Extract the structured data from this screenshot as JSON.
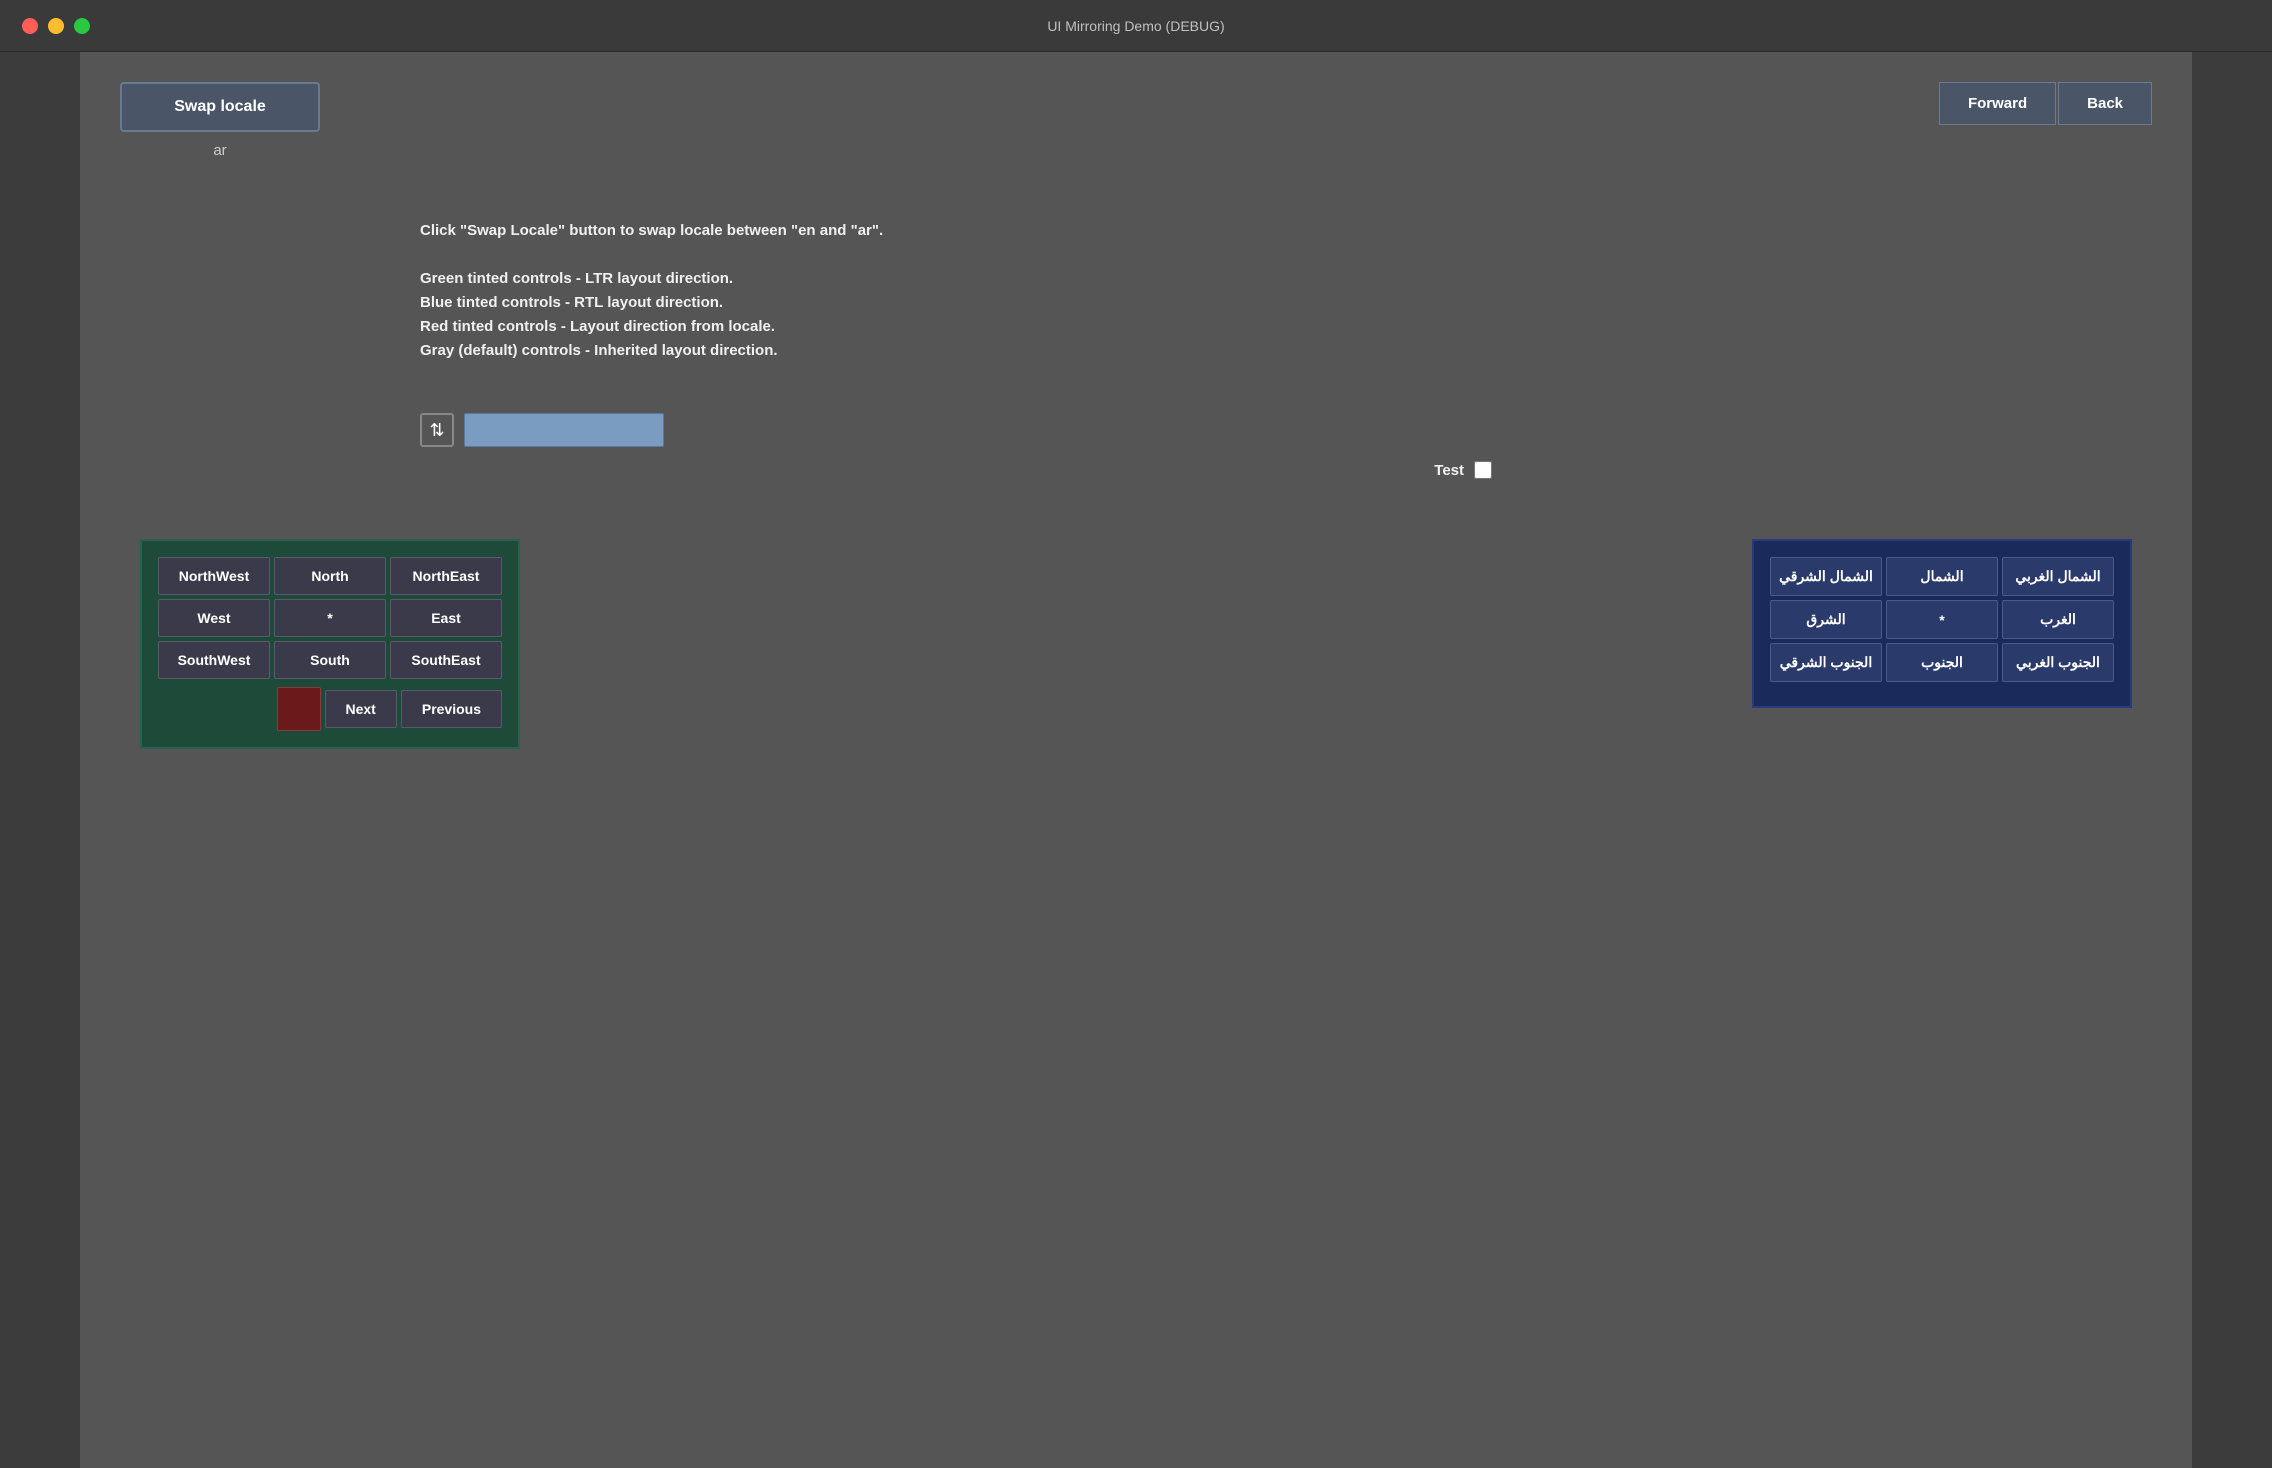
{
  "titlebar": {
    "title": "UI Mirroring Demo (DEBUG)"
  },
  "toolbar": {
    "swap_locale_label": "Swap locale",
    "locale_value": "ar",
    "forward_label": "Forward",
    "back_label": "Back"
  },
  "instructions": {
    "line1": "Click \"Swap Locale\" button to swap locale between \"en  and \"ar\".",
    "line2": "Green tinted controls - LTR layout direction.",
    "line3": "Blue tinted controls - RTL layout direction.",
    "line4": "Red tinted controls - Layout direction from locale.",
    "line5": "Gray (default) controls - Inherited layout direction."
  },
  "test_row": {
    "label": "Test"
  },
  "ltr_panel": {
    "northwest": "NorthWest",
    "north": "North",
    "northeast": "NorthEast",
    "west": "West",
    "center": "*",
    "east": "East",
    "southwest": "SouthWest",
    "south": "South",
    "southeast": "SouthEast",
    "next": "Next",
    "previous": "Previous"
  },
  "rtl_panel": {
    "northwest": "الشمال الغربي",
    "north": "الشمال",
    "northeast": "الشمال الشرقي",
    "west": "الغرب",
    "center": "*",
    "east": "الشرق",
    "southwest": "الجنوب الغربي",
    "south": "الجنوب",
    "southeast": "الجنوب الشرقي"
  },
  "colors": {
    "ltr_bg": "#1e4a3a",
    "rtl_bg": "#1a2a5a",
    "swatch": "#6a1a1a",
    "window_bg": "#555555"
  }
}
